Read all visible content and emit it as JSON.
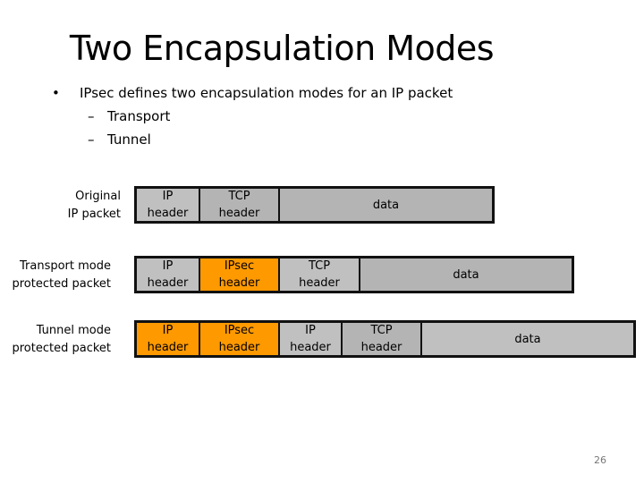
{
  "slide": {
    "title": "Two Encapsulation Modes",
    "bullet": {
      "marker": "•",
      "text": "IPsec defines two encapsulation modes for an IP packet"
    },
    "sub_bullets": [
      {
        "marker": "–",
        "text": "Transport"
      },
      {
        "marker": "–",
        "text": "Tunnel"
      }
    ],
    "page_number": "26"
  },
  "colors": {
    "plain_header": "#c0c0c0",
    "ipsec_added": "#ff9900",
    "border": "#111111"
  },
  "packets": [
    {
      "label_line1": "Original",
      "label_line2": "IP packet",
      "cells": [
        {
          "line1": "IP",
          "line2": "header",
          "kind": "plain"
        },
        {
          "line1": "TCP",
          "line2": "header",
          "kind": "plain"
        },
        {
          "line1": "data",
          "line2": "",
          "kind": "plain"
        }
      ]
    },
    {
      "label_line1": "Transport mode",
      "label_line2": "protected packet",
      "cells": [
        {
          "line1": "IP",
          "line2": "header",
          "kind": "plain"
        },
        {
          "line1": "IPsec",
          "line2": "header",
          "kind": "ipsec"
        },
        {
          "line1": "TCP",
          "line2": "header",
          "kind": "plain"
        },
        {
          "line1": "data",
          "line2": "",
          "kind": "plain"
        }
      ]
    },
    {
      "label_line1": "Tunnel mode",
      "label_line2": "protected packet",
      "cells": [
        {
          "line1": "IP",
          "line2": "header",
          "kind": "ipsec"
        },
        {
          "line1": "IPsec",
          "line2": "header",
          "kind": "ipsec"
        },
        {
          "line1": "IP",
          "line2": "header",
          "kind": "plain"
        },
        {
          "line1": "TCP",
          "line2": "header",
          "kind": "plain"
        },
        {
          "line1": "data",
          "line2": "",
          "kind": "plain"
        }
      ]
    }
  ]
}
